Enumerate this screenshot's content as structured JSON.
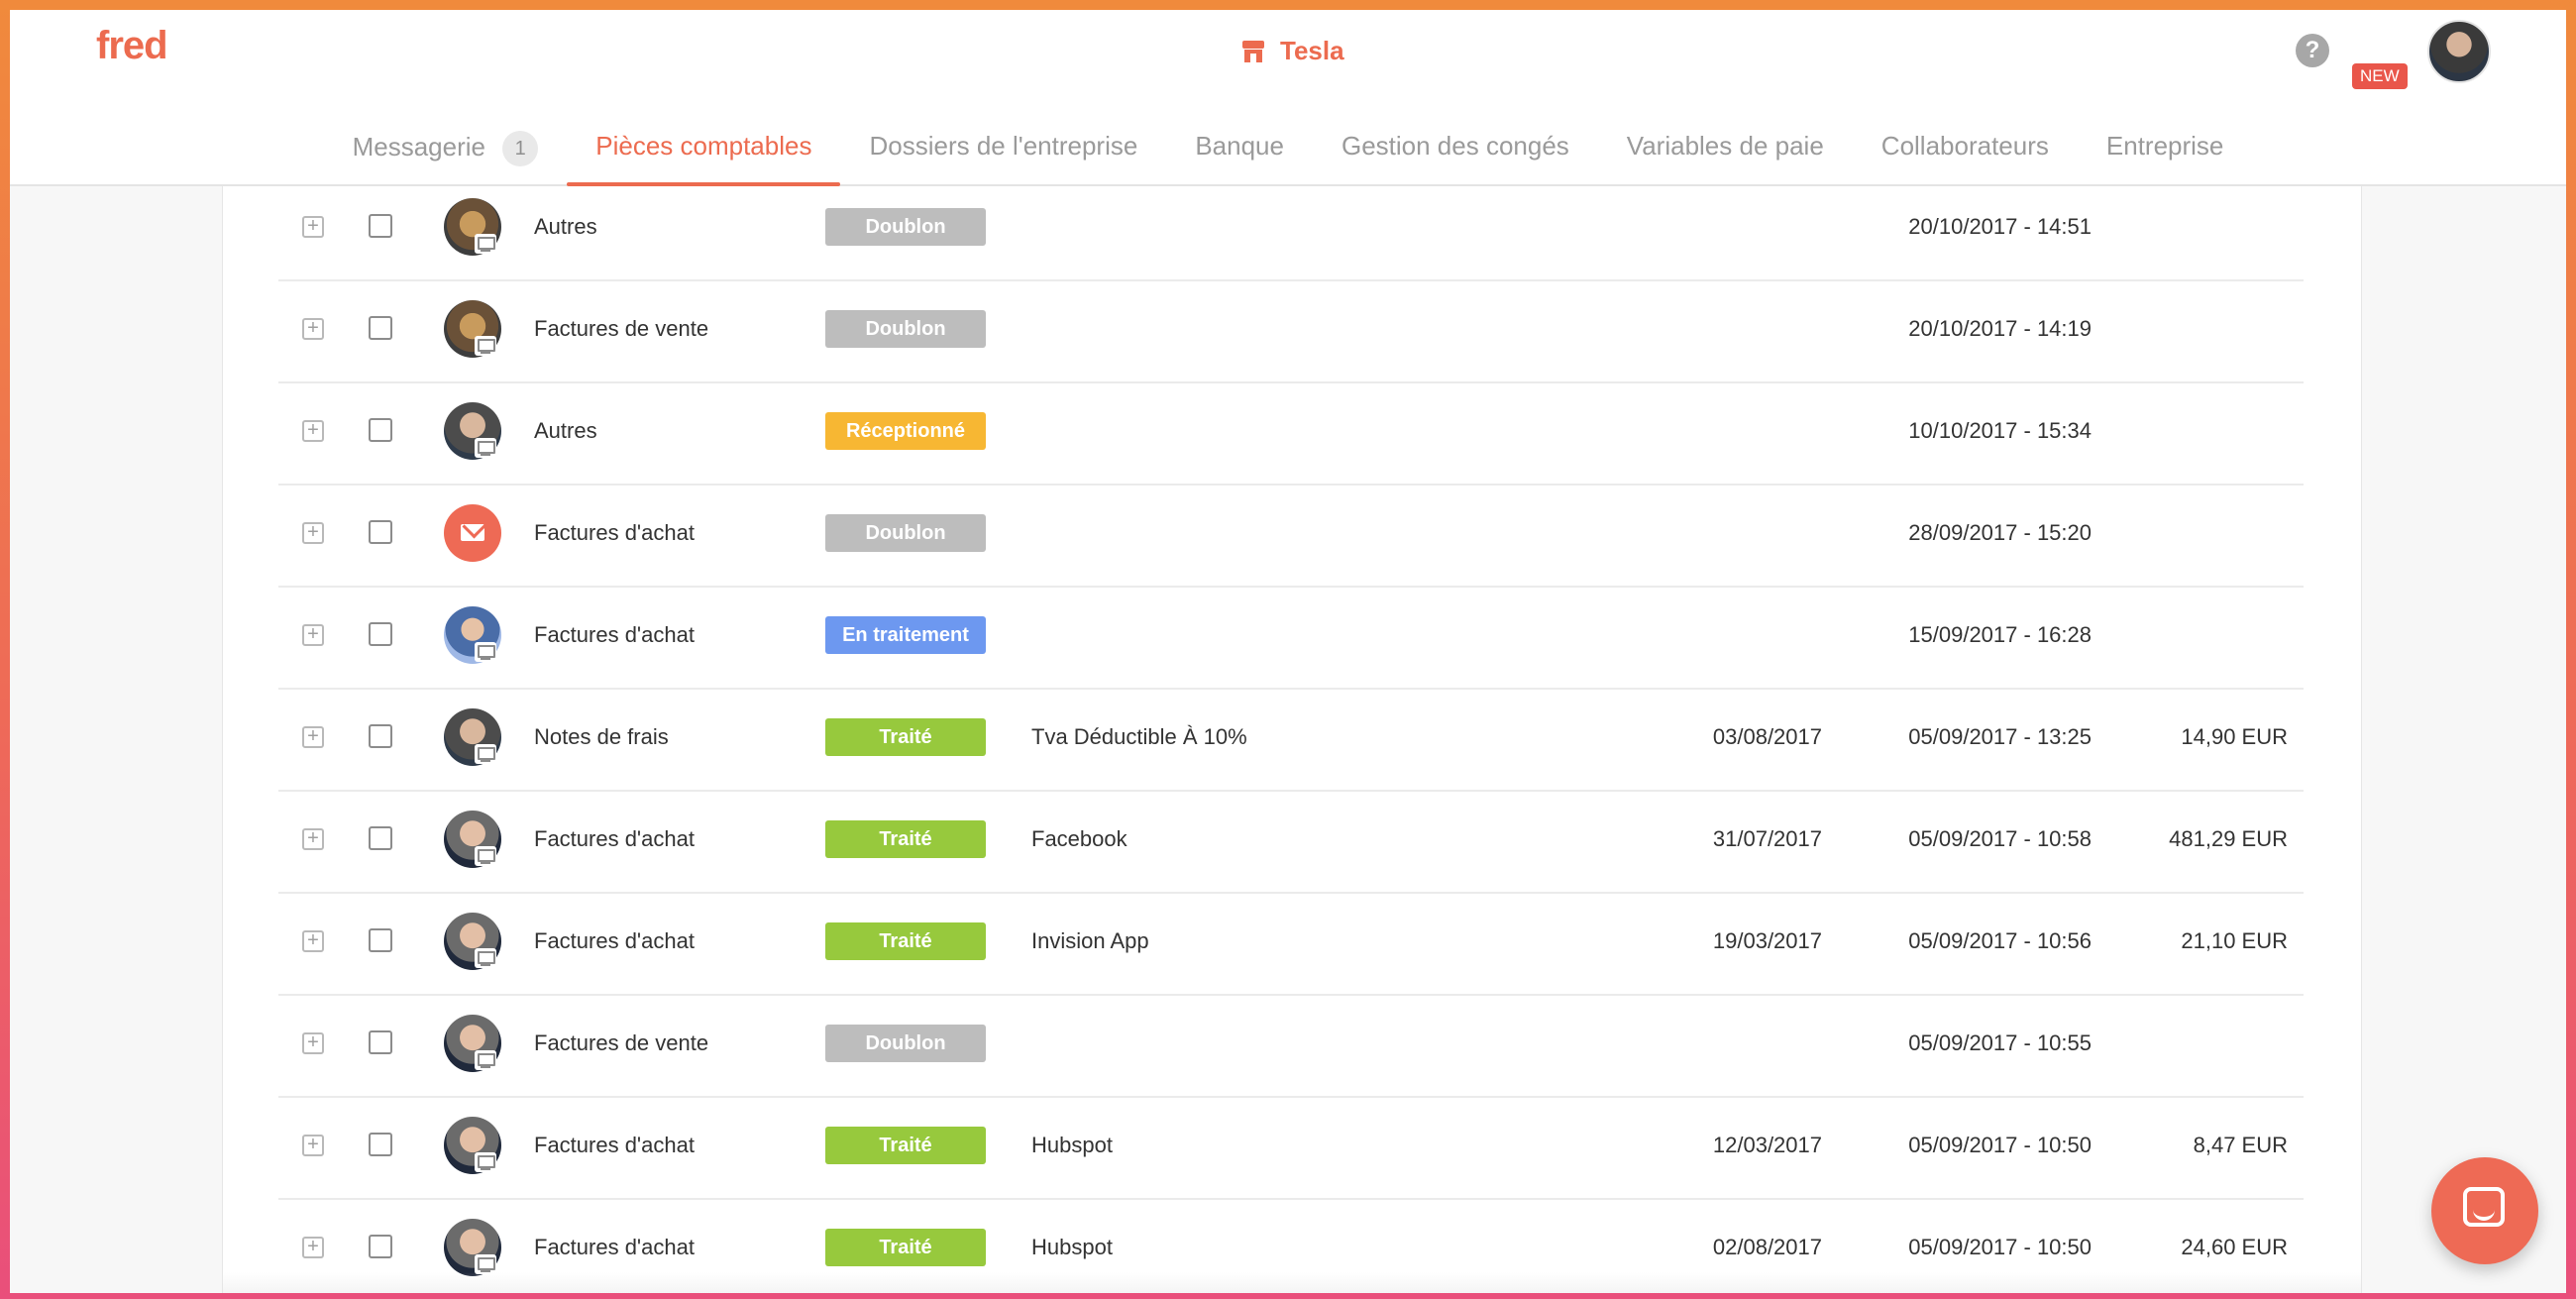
{
  "header": {
    "logo": "fred",
    "company": "Tesla",
    "help": "?",
    "new_badge": "NEW"
  },
  "tabs": [
    {
      "label": "Messagerie",
      "count": "1"
    },
    {
      "label": "Pièces comptables",
      "active": true
    },
    {
      "label": "Dossiers de l'entreprise"
    },
    {
      "label": "Banque"
    },
    {
      "label": "Gestion des congés"
    },
    {
      "label": "Variables de paie"
    },
    {
      "label": "Collaborateurs"
    },
    {
      "label": "Entreprise"
    }
  ],
  "status_colors": {
    "Doublon": "#bdbdbd",
    "Réceptionné": "#f7b733",
    "En traitement": "#6d98f0",
    "Traité": "#97c93d"
  },
  "rows": [
    {
      "avatar": "bear",
      "category": "Autres",
      "status": "Doublon",
      "supplier": "",
      "doc_date": "",
      "upload_date": "20/10/2017 - 14:51",
      "amount": ""
    },
    {
      "avatar": "bear",
      "category": "Factures de vente",
      "status": "Doublon",
      "supplier": "",
      "doc_date": "",
      "upload_date": "20/10/2017 - 14:19",
      "amount": ""
    },
    {
      "avatar": "person",
      "category": "Autres",
      "status": "Réceptionné",
      "supplier": "",
      "doc_date": "",
      "upload_date": "10/10/2017 - 15:34",
      "amount": ""
    },
    {
      "avatar": "mail-icon",
      "category": "Factures d'achat",
      "status": "Doublon",
      "supplier": "",
      "doc_date": "",
      "upload_date": "28/09/2017 - 15:20",
      "amount": ""
    },
    {
      "avatar": "person-blue",
      "category": "Factures d'achat",
      "status": "En traitement",
      "supplier": "",
      "doc_date": "",
      "upload_date": "15/09/2017 - 16:28",
      "amount": ""
    },
    {
      "avatar": "person",
      "category": "Notes de frais",
      "status": "Traité",
      "supplier": "Tva Déductible À 10%",
      "doc_date": "03/08/2017",
      "upload_date": "05/09/2017 - 13:25",
      "amount": "14,90 EUR"
    },
    {
      "avatar": "person-dark",
      "category": "Factures d'achat",
      "status": "Traité",
      "supplier": "Facebook",
      "doc_date": "31/07/2017",
      "upload_date": "05/09/2017 - 10:58",
      "amount": "481,29 EUR"
    },
    {
      "avatar": "person-dark",
      "category": "Factures d'achat",
      "status": "Traité",
      "supplier": "Invision App",
      "doc_date": "19/03/2017",
      "upload_date": "05/09/2017 - 10:56",
      "amount": "21,10 EUR"
    },
    {
      "avatar": "person-dark",
      "category": "Factures de vente",
      "status": "Doublon",
      "supplier": "",
      "doc_date": "",
      "upload_date": "05/09/2017 - 10:55",
      "amount": ""
    },
    {
      "avatar": "person-dark",
      "category": "Factures d'achat",
      "status": "Traité",
      "supplier": "Hubspot",
      "doc_date": "12/03/2017",
      "upload_date": "05/09/2017 - 10:50",
      "amount": "8,47 EUR"
    },
    {
      "avatar": "person-dark",
      "category": "Factures d'achat",
      "status": "Traité",
      "supplier": "Hubspot",
      "doc_date": "02/08/2017",
      "upload_date": "05/09/2017 - 10:50",
      "amount": "24,60 EUR"
    }
  ]
}
